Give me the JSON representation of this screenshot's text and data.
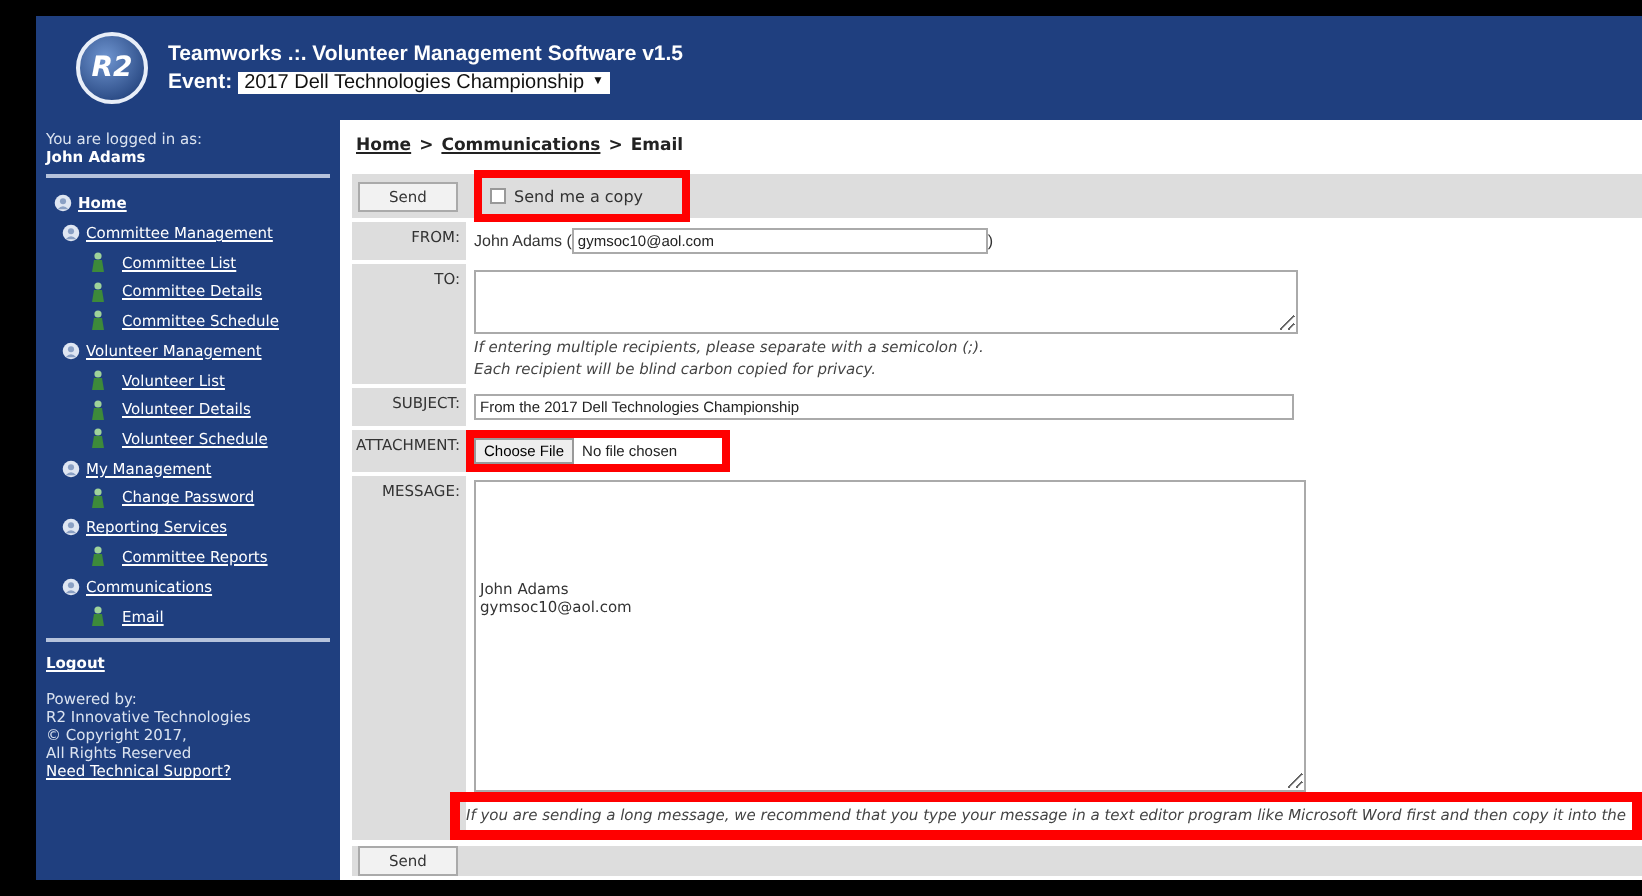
{
  "header": {
    "logo": "R2",
    "title": "Teamworks .:. Volunteer Management Software v1.5",
    "event_label": "Event:",
    "event_value": "2017 Dell Technologies Championship",
    "event_caret": "▼"
  },
  "sidebar": {
    "logged_in_label": "You are logged in as:",
    "user": "John Adams",
    "items": [
      {
        "label": "Home",
        "children": [
          {
            "label": "Committee Management",
            "children": [
              {
                "label": "Committee List"
              },
              {
                "label": "Committee Details"
              },
              {
                "label": "Committee Schedule"
              }
            ]
          },
          {
            "label": "Volunteer Management",
            "children": [
              {
                "label": "Volunteer List"
              },
              {
                "label": "Volunteer Details"
              },
              {
                "label": "Volunteer Schedule"
              }
            ]
          },
          {
            "label": "My Management",
            "children": [
              {
                "label": "Change Password"
              }
            ]
          },
          {
            "label": "Reporting Services",
            "children": [
              {
                "label": "Committee Reports"
              }
            ]
          },
          {
            "label": "Communications",
            "children": [
              {
                "label": "Email"
              }
            ]
          }
        ]
      }
    ],
    "logout": "Logout",
    "powered": [
      "Powered by:",
      "R2 Innovative Technologies",
      "© Copyright 2017,",
      "All Rights Reserved"
    ],
    "support_link": "Need Technical Support?"
  },
  "breadcrumb": [
    {
      "text": "Home",
      "kind": "link"
    },
    {
      "text": ">",
      "kind": "separator"
    },
    {
      "text": "Communications",
      "kind": "link"
    },
    {
      "text": ">",
      "kind": "separator"
    },
    {
      "text": "Email",
      "kind": "current"
    }
  ],
  "form": {
    "send_button": "Send",
    "copy_checkbox": {
      "label": "Send me a copy",
      "checked": false
    },
    "from_label": "FROM:",
    "from_name": "John Adams (",
    "from_email": "gymsoc10@aol.com",
    "from_close": ")",
    "to_label": "TO:",
    "to_hint": [
      "If entering multiple recipients, please separate with a semicolon (;).",
      "Each recipient will be blind carbon copied for privacy."
    ],
    "subject_label": "SUBJECT:",
    "subject_value": "From the 2017 Dell Technologies Championship",
    "attachment_label": "ATTACHMENT:",
    "choose_file": "Choose File",
    "no_file": "No file chosen",
    "message_label": "MESSAGE:",
    "message_value": "\n\n\n\n\nJohn Adams\ngymsoc10@aol.com",
    "message_hint": "If you are sending a long message, we recommend that you type your message in a text editor program like Microsoft Word first and then copy it into the",
    "bottom_send_button": "Send"
  }
}
